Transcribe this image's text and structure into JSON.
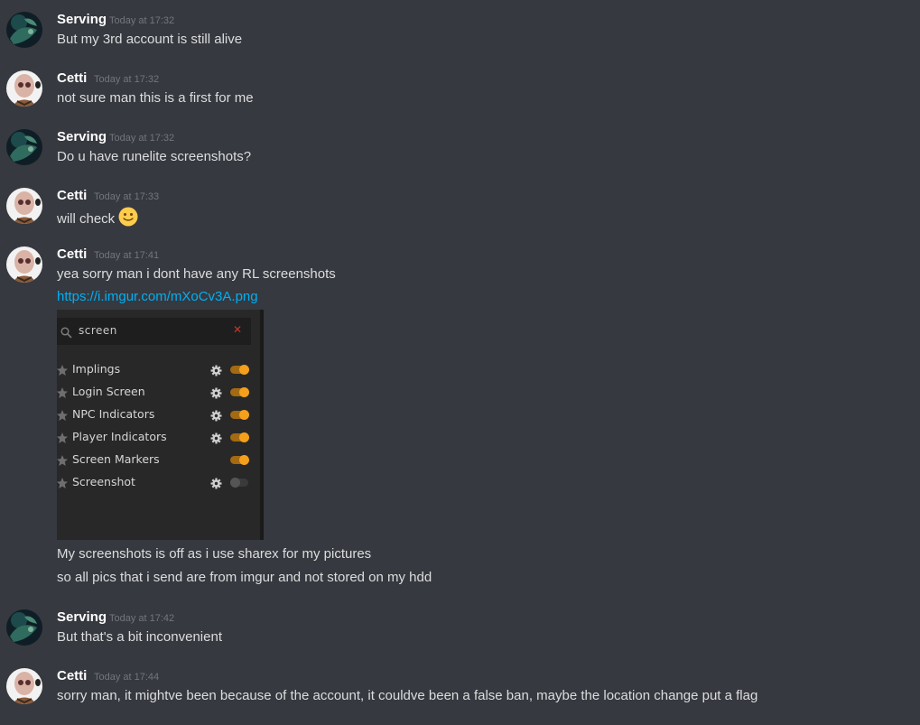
{
  "messages": [
    {
      "author": "Serving",
      "time": "Today at 17:32",
      "lines": [
        "But my 3rd account is still alive"
      ]
    },
    {
      "author": "Cetti",
      "time": "Today at 17:32",
      "lines": [
        "not sure man this is a first for me"
      ]
    },
    {
      "author": "Serving",
      "time": "Today at 17:32",
      "lines": [
        "Do u have runelite screenshots?"
      ]
    },
    {
      "author": "Cetti",
      "time": "Today at 17:33",
      "lines": [
        "will check"
      ],
      "emoji": "slightly-smiling-face"
    },
    {
      "author": "Cetti",
      "time": "Today at 17:41",
      "lines": [
        "yea sorry man i dont have any RL screenshots"
      ],
      "link": "https://i.imgur.com/mXoCv3A.png",
      "after_lines": [
        "My screenshots is off as i use sharex for my pictures",
        "so all pics that i send are from imgur and not stored on my hdd"
      ]
    },
    {
      "author": "Serving",
      "time": "Today at 17:42",
      "lines": [
        "But that's a bit inconvenient"
      ]
    },
    {
      "author": "Cetti",
      "time": "Today at 17:44",
      "lines": [
        "sorry man, it mightve been because of the account, it couldve been a false ban, maybe the location change put a flag"
      ]
    }
  ],
  "embed": {
    "search_value": "screen",
    "clear_icon": "close-icon",
    "plugins": [
      {
        "name": "Implings",
        "has_config": true,
        "enabled": true
      },
      {
        "name": "Login Screen",
        "has_config": true,
        "enabled": true
      },
      {
        "name": "NPC Indicators",
        "has_config": true,
        "enabled": true
      },
      {
        "name": "Player Indicators",
        "has_config": true,
        "enabled": true
      },
      {
        "name": "Screen Markers",
        "has_config": false,
        "enabled": true
      },
      {
        "name": "Screenshot",
        "has_config": true,
        "enabled": false
      }
    ]
  },
  "colors": {
    "background": "#36393f",
    "author": "#ffffff",
    "timestamp": "#72767d",
    "message_text": "#dcddde",
    "link": "#00b0f4",
    "toggle_on": "#f4a01c"
  }
}
